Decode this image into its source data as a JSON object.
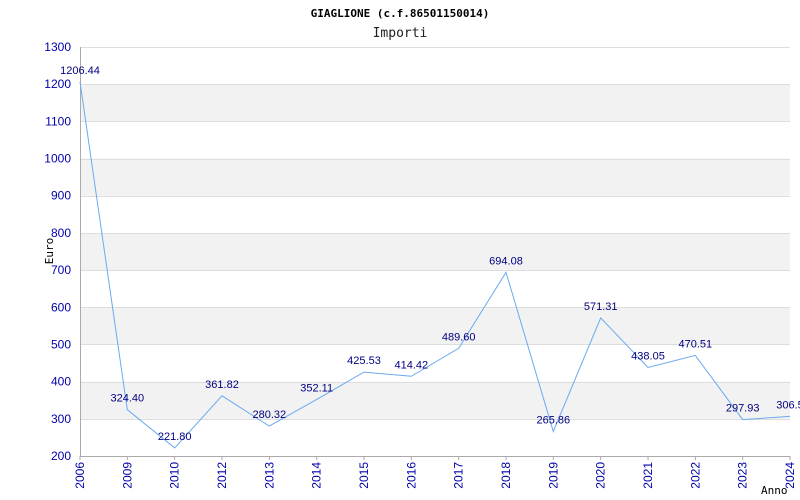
{
  "chart_data": {
    "type": "line",
    "title": "GIAGLIONE (c.f.86501150014)",
    "subtitle": "Importi",
    "ylabel": "Euro",
    "xlabel": "Anno",
    "ylim": [
      200,
      1300
    ],
    "yticks": [
      200,
      300,
      400,
      500,
      600,
      700,
      800,
      900,
      1000,
      1100,
      1200,
      1300
    ],
    "grid": true,
    "categories": [
      "2006",
      "2009",
      "2010",
      "2012",
      "2013",
      "2014",
      "2015",
      "2016",
      "2017",
      "2018",
      "2019",
      "2020",
      "2021",
      "2022",
      "2023",
      "2024"
    ],
    "values": [
      1206.44,
      324.4,
      221.8,
      361.82,
      280.32,
      352.11,
      425.53,
      414.42,
      489.6,
      694.08,
      265.86,
      571.31,
      438.05,
      470.51,
      297.93,
      306.5
    ],
    "value_labels": [
      "1206.44",
      "324.40",
      "221.80",
      "361.82",
      "280.32",
      "352.11",
      "425.53",
      "414.42",
      "489.60",
      "694.08",
      "265.86",
      "571.31",
      "438.05",
      "470.51",
      "297.93",
      "306.5"
    ],
    "colors": {
      "line": "#6aaaf0",
      "band": "#f2f2f2",
      "gridline": "#dddddd",
      "axis": "#aaaaaa"
    }
  }
}
